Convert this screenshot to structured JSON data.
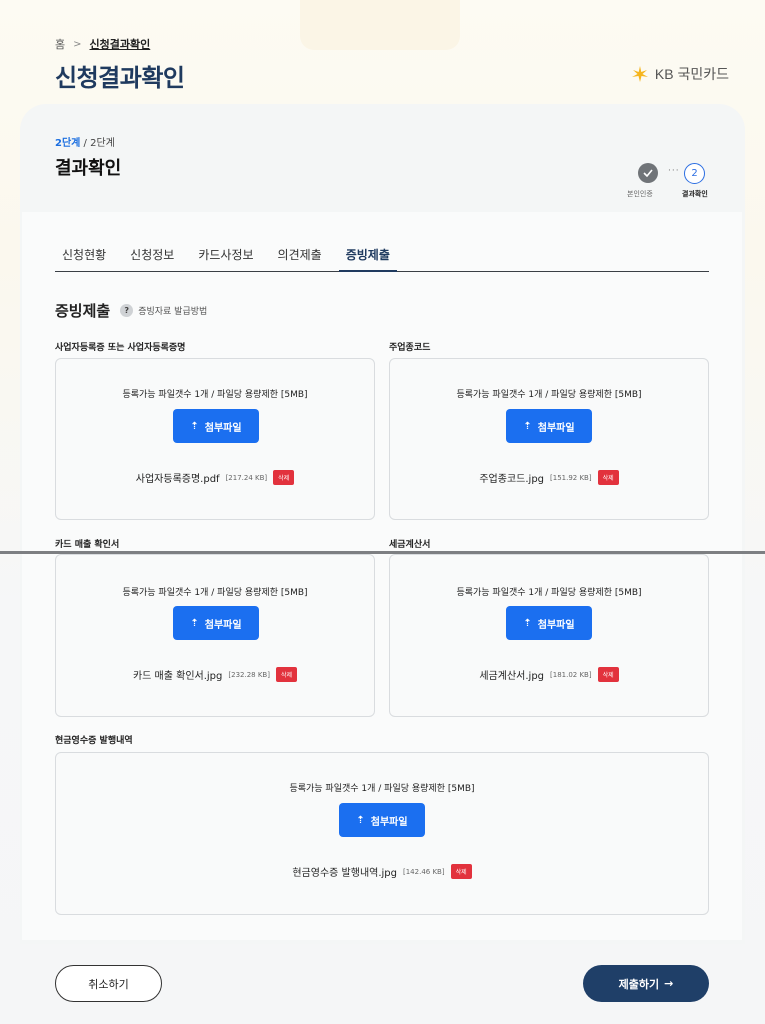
{
  "breadcrumb": {
    "home": "홈",
    "current": "신청결과확인"
  },
  "page_title": "신청결과확인",
  "logo": {
    "text": "KB 국민카드",
    "color": "#f5b51e"
  },
  "step": {
    "current": "2단계",
    "total": "/ 2단계"
  },
  "section_title": "결과확인",
  "stepper": {
    "step1_label": "본인인증",
    "step2_num": "2",
    "step2_label": "결과확인",
    "dots": "···"
  },
  "tabs": [
    {
      "label": "신청현황"
    },
    {
      "label": "신청정보"
    },
    {
      "label": "카드사정보"
    },
    {
      "label": "의견제출"
    },
    {
      "label": "증빙제출",
      "active": true
    }
  ],
  "evidence": {
    "title": "증빙제출",
    "help_q": "?",
    "help": "증빙자료 발급방법"
  },
  "limit_text": "등록가능 파일갯수 1개 / 파일당 용량제한 [5MB]",
  "attach_label": "첨부파일",
  "delete_label": "삭제",
  "uploads": [
    {
      "label": "사업자등록증 또는 사업자등록증명",
      "file": "사업자등록증명.pdf",
      "size": "[217.24 KB]"
    },
    {
      "label": "주업종코드",
      "file": "주업종코드.jpg",
      "size": "[151.92 KB]"
    },
    {
      "label": "카드 매출 확인서",
      "file": "카드 매출 확인서.jpg",
      "size": "[232.28 KB]"
    },
    {
      "label": "세금계산서",
      "file": "세금계산서.jpg",
      "size": "[181.02 KB]"
    },
    {
      "label": "현금영수증 발행내역",
      "file": "현금영수증 발행내역.jpg",
      "size": "[142.46 KB]"
    }
  ],
  "buttons": {
    "cancel": "취소하기",
    "submit": "제출하기",
    "submit_arrow": "→"
  },
  "colors": {
    "primary": "#1b6ff0",
    "navy": "#1f3a5f",
    "danger": "#e2323d"
  }
}
